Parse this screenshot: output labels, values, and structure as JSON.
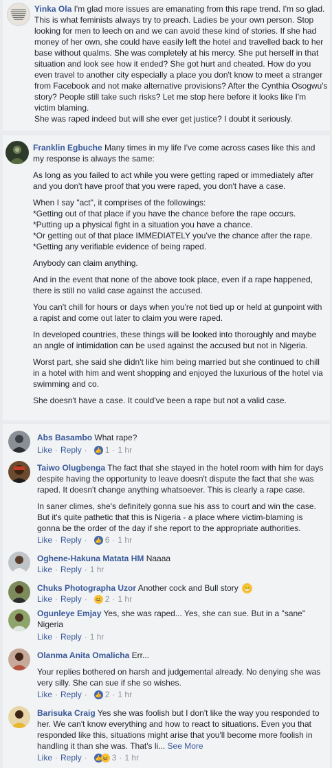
{
  "comments": [
    {
      "name": "Yinka Ola",
      "text": "I'm glad more issues are emanating from this rape trend. I'm so glad. This is what feminists always try to preach. Ladies be your own person. Stop looking for men to leech on and we can avoid these kind of stories. If she had money of her own, she could have easily left the hotel and travelled back to her base without qualms. She was completely at his mercy. She put herself in that situation and look see how it ended? She got hurt and cheated. How do you even travel to another city especially a place you don't know to meet a stranger from Facebook and not make alternative provisions? After the Cynthia Osogwu's story? People still take such risks? Let me stop here before it looks like I'm victim blaming.",
      "text2": "She was raped indeed but will she ever get justice? I doubt it seriously."
    },
    {
      "name": "Franklin Egbuche",
      "paragraphs": [
        "Many times in my life I've come across cases like this and my response is always the same:",
        "As long as you failed to act while you were getting raped or immediately after and you don't have proof that you were raped, you don't have a case.",
        "When I say \"act\", it comprises of the followings:\n*Getting out of that place if you have the chance before the rape occurs.\n*Putting up a physical fight in a situation you have a chance.\n*Or getting out of that place IMMEDIATELY you've the chance after the rape.\n*Getting any verifiable evidence of being raped.",
        "Anybody can claim anything.",
        "And in the event that none of the above took place, even if a rape happened, there is still no valid case against the accused.",
        "You can't chill for hours or days when you're not tied up or held at gunpoint with a rapist and come out later to claim you were raped.",
        "In developed countries, these things will be looked into thoroughly and maybe an angle of intimidation can be used against the accused but not in Nigeria.",
        "Worst part, she said she didn't like him being married but she continued to chill in a hotel with him and went shopping and enjoyed the luxurious of the hotel via swimming and co.",
        "She doesn't have a case. It could've been a rape but not a valid case."
      ]
    }
  ],
  "actions": {
    "like": "Like",
    "reply": "Reply",
    "sep": "·"
  },
  "replies": [
    {
      "name": "Abs Basambo",
      "text": "What rape?",
      "reactions": "1",
      "time": "1 hr"
    },
    {
      "name": "Taiwo Olugbenga",
      "text": "The fact that she stayed in the hotel room with him for days despite having the opportunity to leave doesn't dispute the fact that she was raped. It doesn't change anything whatsoever. This is clearly a rape case.",
      "text2": "In saner climes, she's definitely gonna sue his ass to court and win the case. But it's quite pathetic that this is Nigeria - a place where victim-blaming is gonna be the order of the day if she report to the appropriate authorities.",
      "reactions": "6",
      "time": "1 hr"
    },
    {
      "name": "Oghene-Hakuna Matata HM",
      "text": "Naaaa",
      "time": "1 hr"
    },
    {
      "name": "Chuks Photographa Uzor",
      "text": "Another cock and Bull story",
      "reactions": "2",
      "time": "1 hr"
    },
    {
      "name": "Ogunleye Emjay",
      "text": "Yes, she was raped... Yes, she can sue. But in a \"sane\" Nigeria",
      "time": "1 hr"
    },
    {
      "name": "Olanma Anita Omalicha",
      "text": "Err...",
      "text2": "Your replies bothered on harsh and judgemental already. No denying she was very silly. She can sue if she so wishes.",
      "reactions": "2",
      "time": "1 hr"
    },
    {
      "name": "Barisuka Craig",
      "text": "Yes she was foolish but I don't like the way you responded to her. We can't know everything and how to react to situations. Even you that responded like this, situations might arise that you'll become more foolish in handling it than she was. That's li...",
      "see_more": "See More",
      "reactions": "3",
      "time": "1 hr"
    }
  ]
}
